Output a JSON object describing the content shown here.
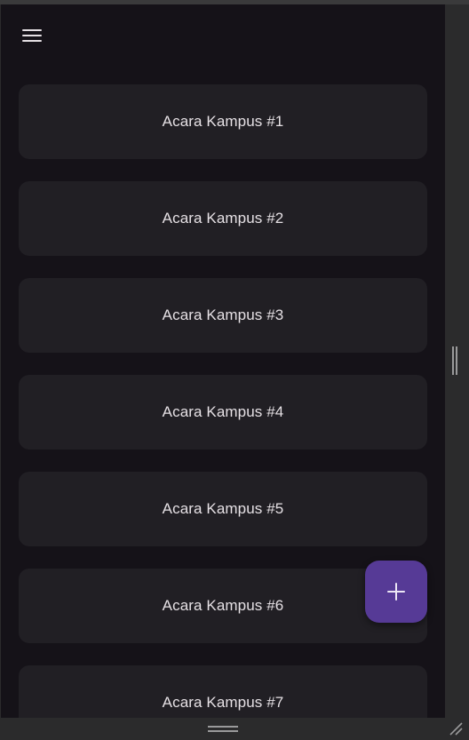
{
  "toolbar": {
    "menu_icon": "menu-icon"
  },
  "events": [
    {
      "title": "Acara Kampus #1"
    },
    {
      "title": "Acara Kampus #2"
    },
    {
      "title": "Acara Kampus #3"
    },
    {
      "title": "Acara Kampus #4"
    },
    {
      "title": "Acara Kampus #5"
    },
    {
      "title": "Acara Kampus #6"
    },
    {
      "title": "Acara Kampus #7"
    }
  ],
  "fab": {
    "icon": "plus-icon"
  },
  "colors": {
    "background": "#151218",
    "card": "#211f24",
    "text": "#e6e1e5",
    "fab": "#563a96",
    "chrome": "#2b2b2c"
  }
}
